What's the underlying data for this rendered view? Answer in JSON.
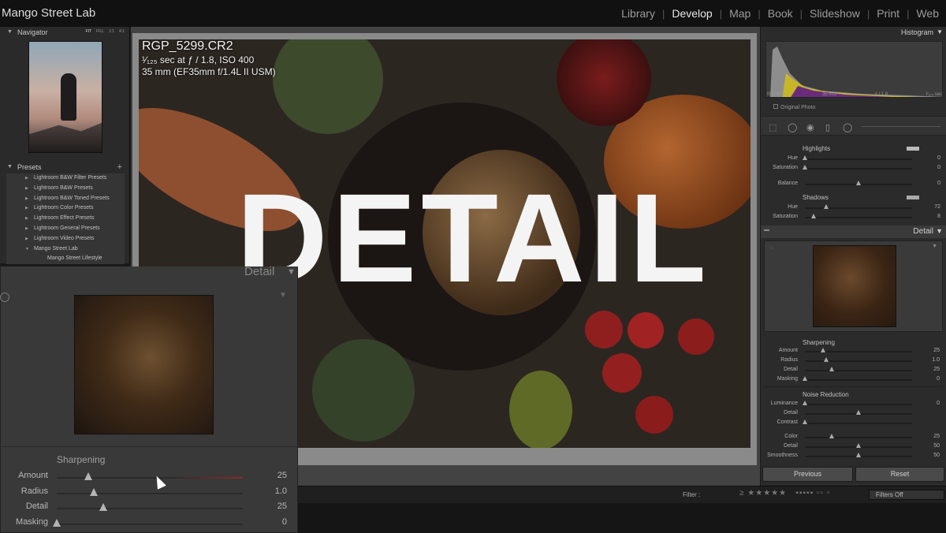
{
  "app": {
    "name": "Mango Street Lab"
  },
  "modules": [
    "Library",
    "Develop",
    "Map",
    "Book",
    "Slideshow",
    "Print",
    "Web"
  ],
  "active_module": "Develop",
  "navigator": {
    "title": "Navigator",
    "zooms": [
      "FIT",
      "FILL",
      "1:1",
      "4:1"
    ]
  },
  "presets": {
    "title": "Presets",
    "items": [
      "Lightroom B&W Filter Presets",
      "Lightroom B&W Presets",
      "Lightroom B&W Toned Presets",
      "Lightroom Color Presets",
      "Lightroom Effect Presets",
      "Lightroom General Presets",
      "Lightroom Video Presets",
      "Mango Street Lab"
    ],
    "sub_item": "Mango Street Lifestyle"
  },
  "photo_info": {
    "filename": "RGP_5299.CR2",
    "exposure": "¹⁄₁₂₅ sec at ƒ / 1.8, ISO 400",
    "lens": "35 mm (EF35mm f/1.4L II USM)"
  },
  "overlay_title": "DETAIL",
  "histogram": {
    "title": "Histogram",
    "iso": "ISO 400",
    "focal": "35 mm",
    "aperture": "ƒ / 1.8",
    "shutter": "¹⁄₁₂₅ sec",
    "original_photo": "Original Photo"
  },
  "split_toning": {
    "highlights_label": "Highlights",
    "shadows_label": "Shadows",
    "rows": [
      {
        "label": "Hue",
        "value": "0",
        "pos": 0
      },
      {
        "label": "Saturation",
        "value": "0",
        "pos": 0
      },
      {
        "label": "Balance",
        "value": "0",
        "pos": 0.5
      },
      {
        "label": "Hue",
        "value": "72",
        "pos": 0.2
      },
      {
        "label": "Saturation",
        "value": "8",
        "pos": 0.08
      }
    ]
  },
  "detail_panel": {
    "title": "Detail",
    "sharpening_label": "Sharpening",
    "sharpening": [
      {
        "label": "Amount",
        "value": "25",
        "pos": 0.17
      },
      {
        "label": "Radius",
        "value": "1.0",
        "pos": 0.2
      },
      {
        "label": "Detail",
        "value": "25",
        "pos": 0.25
      },
      {
        "label": "Masking",
        "value": "0",
        "pos": 0
      }
    ],
    "noise_label": "Noise Reduction",
    "noise": [
      {
        "label": "Luminance",
        "value": "0",
        "pos": 0
      },
      {
        "label": "Detail",
        "value": "",
        "pos": 0.5
      },
      {
        "label": "Contrast",
        "value": "",
        "pos": 0
      },
      {
        "label": "Color",
        "value": "25",
        "pos": 0.25
      },
      {
        "label": "Detail",
        "value": "50",
        "pos": 0.5
      },
      {
        "label": "Smoothness",
        "value": "50",
        "pos": 0.5
      }
    ]
  },
  "buttons": {
    "previous": "Previous",
    "reset": "Reset"
  },
  "filmstrip": {
    "filter_label": "Filter :",
    "filters_off": "Filters Off"
  },
  "zoom": {
    "title": "Detail",
    "sharpening_label": "Sharpening",
    "rows": [
      {
        "label": "Amount",
        "value": "25",
        "pos": 0.17
      },
      {
        "label": "Radius",
        "value": "1.0",
        "pos": 0.2
      },
      {
        "label": "Detail",
        "value": "25",
        "pos": 0.25
      },
      {
        "label": "Masking",
        "value": "0",
        "pos": 0
      }
    ]
  },
  "colors": {
    "accent_track": "#8c2b2b",
    "panel": "#2b2b2b",
    "active_text": "#e8e8e8"
  }
}
